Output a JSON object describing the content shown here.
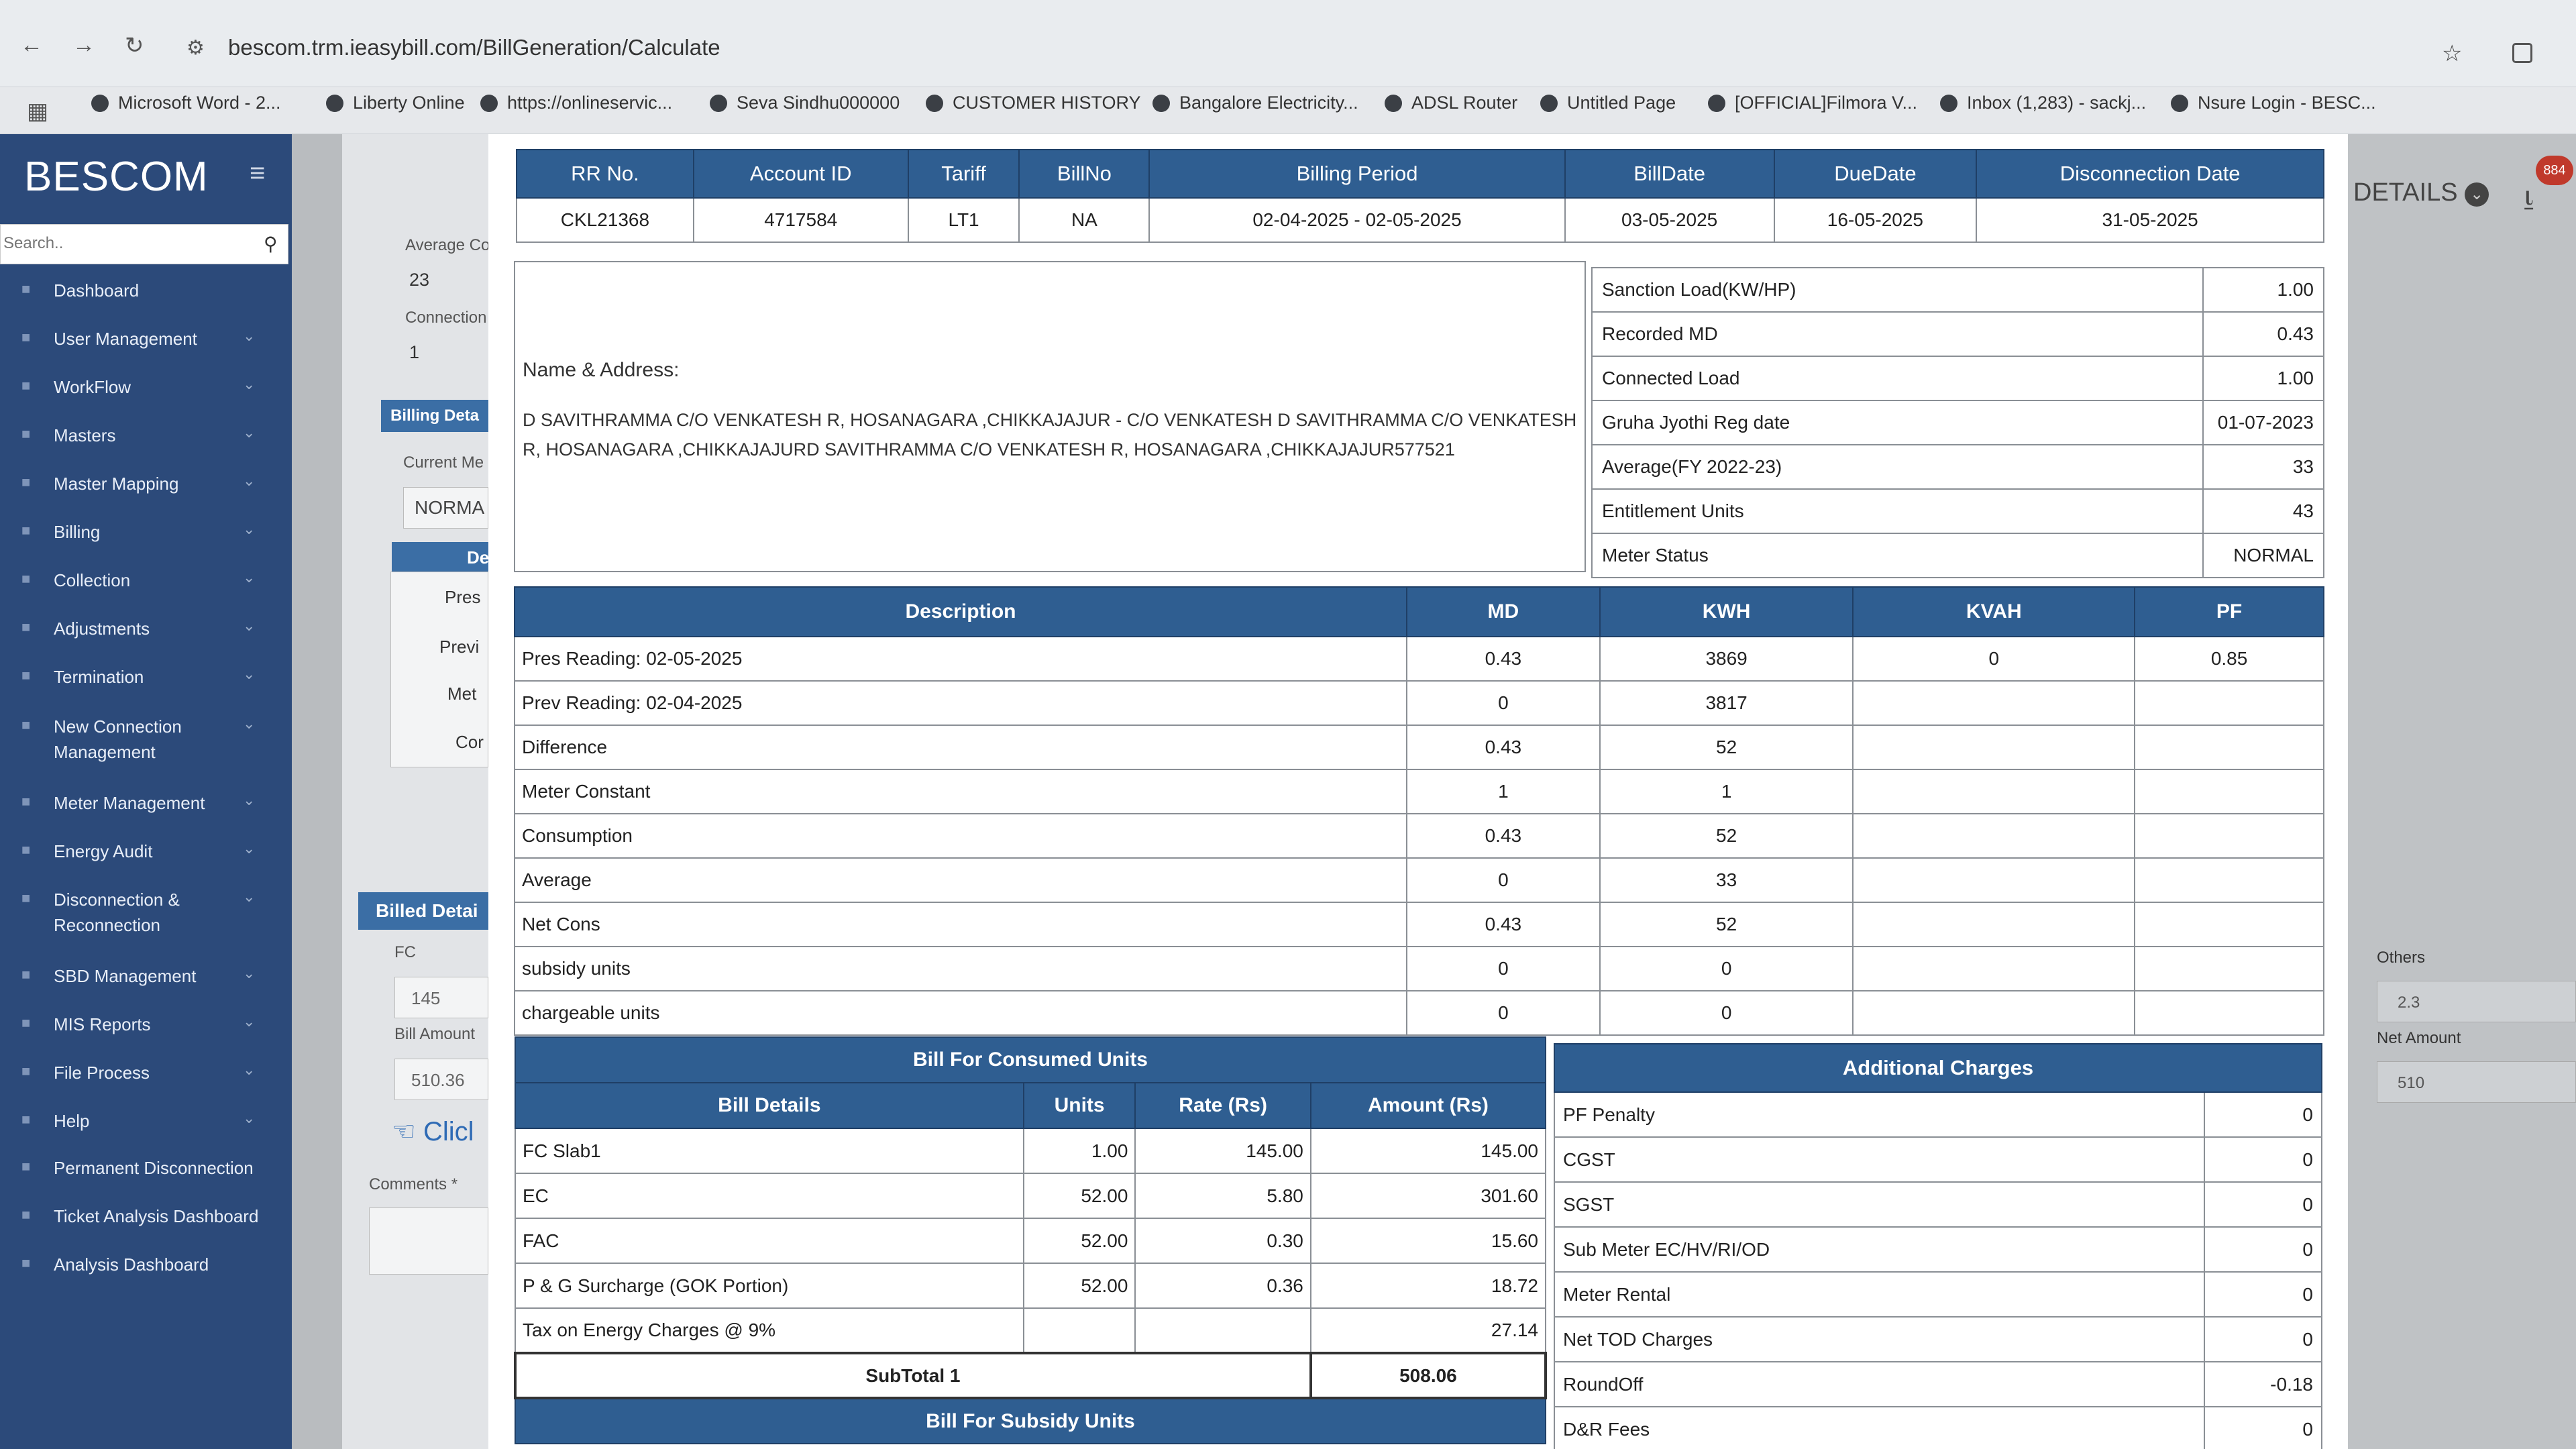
{
  "browser": {
    "url": "bescom.trm.ieasybill.com/BillGeneration/Calculate",
    "bookmarks": [
      "Microsoft Word - 2...",
      "Liberty Online",
      "https://onlineservic...",
      "Seva Sindhu000000",
      "CUSTOMER HISTORY",
      "Bangalore Electricity...",
      "ADSL Router",
      "Untitled Page",
      "[OFFICIAL]Filmora V...",
      "Inbox (1,283) - sackj...",
      "Nsure Login - BESC..."
    ]
  },
  "sidebar": {
    "logo": "BESCOM",
    "search_placeholder": "Search..",
    "items": [
      {
        "label": "Dashboard",
        "chevron": false
      },
      {
        "label": "User Management",
        "chevron": true
      },
      {
        "label": "WorkFlow",
        "chevron": true
      },
      {
        "label": "Masters",
        "chevron": true
      },
      {
        "label": "Master Mapping",
        "chevron": true
      },
      {
        "label": "Billing",
        "chevron": true
      },
      {
        "label": "Collection",
        "chevron": true
      },
      {
        "label": "Adjustments",
        "chevron": true
      },
      {
        "label": "Termination",
        "chevron": true
      },
      {
        "label": "New Connection",
        "label2": "Management",
        "chevron": true
      },
      {
        "label": "Meter Management",
        "chevron": true
      },
      {
        "label": "Energy Audit",
        "chevron": true
      },
      {
        "label": "Disconnection &",
        "label2": "Reconnection",
        "chevron": true
      },
      {
        "label": "SBD Management",
        "chevron": true
      },
      {
        "label": "MIS Reports",
        "chevron": true
      },
      {
        "label": "File Process",
        "chevron": true
      },
      {
        "label": "Help",
        "chevron": true
      },
      {
        "label": "Permanent Disconnection",
        "chevron": false
      },
      {
        "label": "Ticket Analysis Dashboard",
        "chevron": false
      },
      {
        "label": "Analysis Dashboard",
        "chevron": false
      }
    ]
  },
  "background": {
    "average_label": "Average Co",
    "average_value": "23",
    "connection_label": "Connection",
    "connection_value": "1",
    "billing_details_tab": "Billing Deta",
    "current_meter_label": "Current Me",
    "current_meter_value": "NORMA",
    "col_header": "De",
    "rows": [
      "Pres",
      "Previ",
      "Met",
      "Cor"
    ],
    "billed_details_tab": "Billed Detai",
    "fc_label": "FC",
    "fc_value": "145",
    "bill_amount_label": "Bill Amount",
    "bill_amount_value": "510.36",
    "click_text": "Clicl",
    "comments_label": "Comments *",
    "details_label": "DETAILS",
    "notification_count": "884",
    "others_label": "Others",
    "others_value": "2.3",
    "net_amount_label": "Net Amount",
    "net_amount_value": "510"
  },
  "bill": {
    "header_cols": [
      "RR No.",
      "Account ID",
      "Tariff",
      "BillNo",
      "Billing Period",
      "BillDate",
      "DueDate",
      "Disconnection Date"
    ],
    "header_vals": [
      "CKL21368",
      "4717584",
      "LT1",
      "NA",
      "02-04-2025 - 02-05-2025",
      "03-05-2025",
      "16-05-2025",
      "31-05-2025"
    ],
    "name_address_label": "Name & Address:",
    "name_address": "D SAVITHRAMMA C/O VENKATESH R, HOSANAGARA ,CHIKKAJAJUR - C/O VENKATESH D SAVITHRAMMA C/O VENKATESH R, HOSANAGARA ,CHIKKAJAJURD SAVITHRAMMA C/O VENKATESH R, HOSANAGARA ,CHIKKAJAJUR577521",
    "info": [
      {
        "label": "Sanction Load(KW/HP)",
        "value": "1.00"
      },
      {
        "label": "Recorded MD",
        "value": "0.43"
      },
      {
        "label": "Connected Load",
        "value": "1.00"
      },
      {
        "label": "Gruha Jyothi Reg date",
        "value": "01-07-2023"
      },
      {
        "label": "Average(FY 2022-23)",
        "value": "33"
      },
      {
        "label": "Entitlement Units",
        "value": "43"
      },
      {
        "label": "Meter Status",
        "value": "NORMAL"
      }
    ],
    "readings_cols": [
      "Description",
      "MD",
      "KWH",
      "KVAH",
      "PF"
    ],
    "readings": [
      [
        "Pres Reading: 02-05-2025",
        "0.43",
        "3869",
        "0",
        "0.85"
      ],
      [
        "Prev Reading: 02-04-2025",
        "0",
        "3817",
        "",
        ""
      ],
      [
        "Difference",
        "0.43",
        "52",
        "",
        ""
      ],
      [
        "Meter Constant",
        "1",
        "1",
        "",
        ""
      ],
      [
        "Consumption",
        "0.43",
        "52",
        "",
        ""
      ],
      [
        "Average",
        "0",
        "33",
        "",
        ""
      ],
      [
        "Net Cons",
        "0.43",
        "52",
        "",
        ""
      ],
      [
        "subsidy units",
        "0",
        "0",
        "",
        ""
      ],
      [
        "chargeable units",
        "0",
        "0",
        "",
        ""
      ]
    ],
    "consumed_title": "Bill For Consumed Units",
    "consumed_cols": [
      "Bill Details",
      "Units",
      "Rate (Rs)",
      "Amount (Rs)"
    ],
    "consumed": [
      [
        "FC Slab1",
        "1.00",
        "145.00",
        "145.00"
      ],
      [
        "EC",
        "52.00",
        "5.80",
        "301.60"
      ],
      [
        "FAC",
        "52.00",
        "0.30",
        "15.60"
      ],
      [
        "P & G Surcharge (GOK Portion)",
        "52.00",
        "0.36",
        "18.72"
      ],
      [
        "Tax on Energy Charges @ 9%",
        "",
        "",
        "27.14"
      ]
    ],
    "subtotal_label": "SubTotal 1",
    "subtotal_value": "508.06",
    "subsidy_title": "Bill For Subsidy Units",
    "additional_title": "Additional Charges",
    "additional": [
      {
        "label": "PF Penalty",
        "value": "0"
      },
      {
        "label": "CGST",
        "value": "0"
      },
      {
        "label": "SGST",
        "value": "0"
      },
      {
        "label": "Sub Meter EC/HV/RI/OD",
        "value": "0"
      },
      {
        "label": "Meter Rental",
        "value": "0"
      },
      {
        "label": "Net TOD Charges",
        "value": "0"
      },
      {
        "label": "RoundOff",
        "value": "-0.18"
      },
      {
        "label": "D&R Fees",
        "value": "0"
      }
    ]
  }
}
